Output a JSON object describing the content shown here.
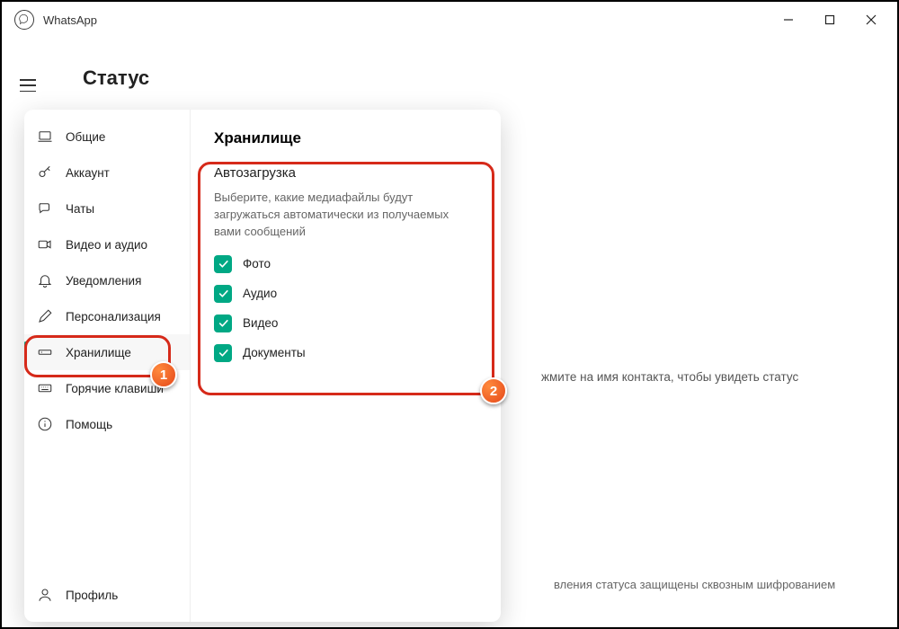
{
  "titlebar": {
    "title": "WhatsApp"
  },
  "status": {
    "title": "Статус"
  },
  "settings": {
    "items": [
      {
        "label": "Общие"
      },
      {
        "label": "Аккаунт"
      },
      {
        "label": "Чаты"
      },
      {
        "label": "Видео и аудио"
      },
      {
        "label": "Уведомления"
      },
      {
        "label": "Персонализация"
      },
      {
        "label": "Хранилище"
      },
      {
        "label": "Горячие клавиши"
      },
      {
        "label": "Помощь"
      }
    ],
    "profile": "Профиль",
    "content": {
      "title": "Хранилище",
      "auto": {
        "heading": "Автозагрузка",
        "desc": "Выберите, какие медиафайлы будут загружаться автоматически из получаемых вами сообщений",
        "options": [
          {
            "label": "Фото"
          },
          {
            "label": "Аудио"
          },
          {
            "label": "Видео"
          },
          {
            "label": "Документы"
          }
        ]
      }
    }
  },
  "background": {
    "hint_partial": "жмите на имя контакта, чтобы увидеть статус",
    "footer_partial": "вления статуса защищены сквозным шифрованием"
  },
  "markers": {
    "m1": "1",
    "m2": "2"
  }
}
